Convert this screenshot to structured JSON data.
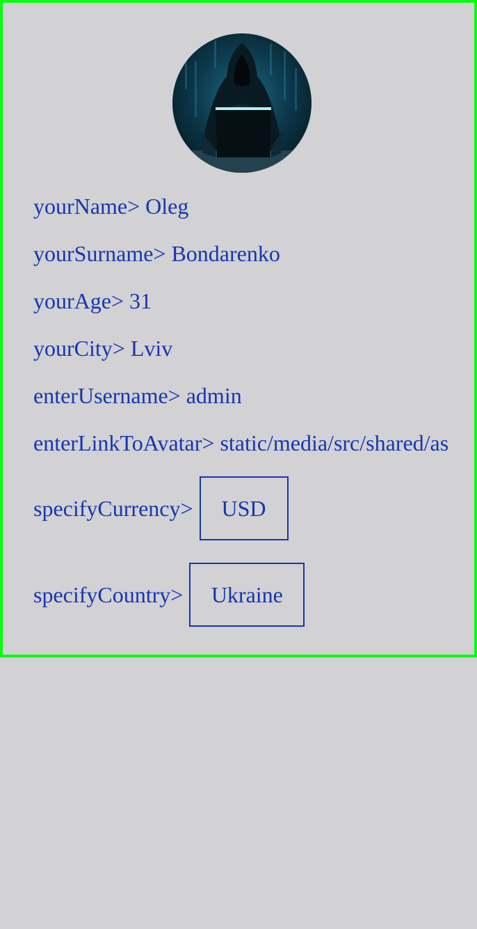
{
  "profile": {
    "name_label": "yourName>",
    "name_value": "Oleg",
    "surname_label": "yourSurname>",
    "surname_value": "Bondarenko",
    "age_label": "yourAge>",
    "age_value": "31",
    "city_label": "yourCity>",
    "city_value": "Lviv",
    "username_label": "enterUsername>",
    "username_value": "admin",
    "avatar_link_label": "enterLinkToAvatar>",
    "avatar_link_value": "static/media/src/shared/as",
    "currency_label": "specifyCurrency>",
    "currency_value": "USD",
    "country_label": "specifyCountry>",
    "country_value": "Ukraine"
  },
  "colors": {
    "background": "#d2d1d4",
    "text": "#1636b0",
    "panel_border": "#0dfb12"
  },
  "icons": {
    "avatar": "hooded-hacker-avatar-icon"
  }
}
